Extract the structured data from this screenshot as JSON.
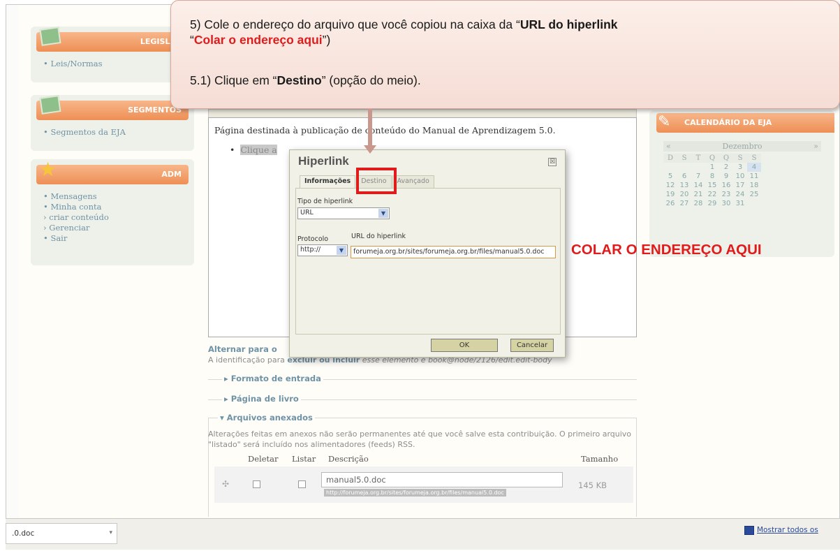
{
  "callout": {
    "line1_prefix": "5) Cole o endereço do arquivo que você copiou na caixa da “",
    "line1_bold": "URL do hiperlink",
    "line2_open": "“",
    "line2_red": "Colar o endereço aqui",
    "line2_close": "”)",
    "line3_prefix": "5.1) Clique em “",
    "line3_bold": "Destino",
    "line3_suffix": "” (opção do meio)."
  },
  "sidebar": {
    "legislacao": {
      "title": "LEGISLAÇ",
      "items": [
        "• Leis/Normas"
      ]
    },
    "segmentos": {
      "title": "SEGMENTOS",
      "items": [
        "• Segmentos da EJA"
      ]
    },
    "adm": {
      "title": "ADM",
      "items": [
        "• Mensagens",
        "• Minha conta",
        "› criar conteúdo",
        "› Gerenciar",
        "• Sair"
      ]
    }
  },
  "editor": {
    "body_text": "Página destinada à publicação de conteúdo do Manual de Aprendizagem 5.0.",
    "bullet_text": "Clique a"
  },
  "dialog": {
    "title": "Hiperlink",
    "close": "☒",
    "tabs": [
      "Informações",
      "Destino",
      "Avançado"
    ],
    "link_type_label": "Tipo de hiperlink",
    "link_type_value": "URL",
    "protocol_label": "Protocolo",
    "protocol_value": "http://",
    "url_label": "URL do hiperlink",
    "url_value": "forumeja.org.br/sites/forumeja.org.br/files/manual5.0.doc",
    "ok_label": "OK",
    "cancel_label": "Cancelar"
  },
  "annotation": {
    "paste_here": "COLAR O ENDEREÇO AQUI"
  },
  "below_editor": {
    "alt_link": "Alternar para o",
    "ident_prefix": "A identificação para ",
    "ident_bold": "excluir ou incluir",
    "ident_suffix": " esse elemento é book@node/2126/edit.edit-body",
    "fieldsets": [
      "▸ Formato de entrada",
      "▸ Página de livro",
      "▾ Arquivos anexados"
    ]
  },
  "attachments": {
    "note": "Alterações feitas em anexos não serão permanentes até que você salve esta contribuição. O primeiro arquivo \"listado\" será incluído nos alimentadores (feeds) RSS.",
    "headers": {
      "delete": "Deletar",
      "list": "Listar",
      "description": "Descrição",
      "size": "Tamanho"
    },
    "row": {
      "description": "manual5.0.doc",
      "url": "http://forumeja.org.br/sites/forumeja.org.br/files/manual5.0.doc",
      "size": "145 KB"
    }
  },
  "calendar": {
    "title": "CALENDÁRIO DA EJA",
    "month": "Dezembro",
    "prev": "«",
    "next": "»",
    "weekdays": [
      "D",
      "S",
      "T",
      "Q",
      "Q",
      "S",
      "S"
    ],
    "weeks": [
      [
        "",
        "",
        "",
        "1",
        "2",
        "3",
        "4"
      ],
      [
        "5",
        "6",
        "7",
        "8",
        "9",
        "10",
        "11"
      ],
      [
        "12",
        "13",
        "14",
        "15",
        "16",
        "17",
        "18"
      ],
      [
        "19",
        "20",
        "21",
        "22",
        "23",
        "24",
        "25"
      ],
      [
        "26",
        "27",
        "28",
        "29",
        "30",
        "31",
        ""
      ]
    ]
  },
  "download_bar": {
    "file": ".0.doc",
    "dropdown": "▾",
    "show_all": "Mostrar todos os"
  },
  "colors": {
    "accent_orange": "#ee8f55",
    "link_blue": "#6f93a6",
    "highlight_red": "#e01b1b"
  }
}
